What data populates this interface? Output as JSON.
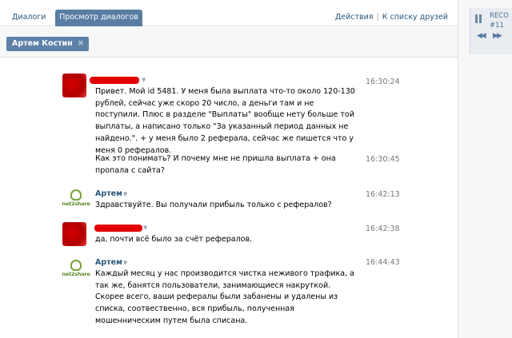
{
  "tabs": {
    "dialogs": "Диалоги",
    "view_dialogs": "Просмотр диалогов"
  },
  "top_actions": {
    "actions": "Действия",
    "separator": "|",
    "to_friends": "К списку друзей"
  },
  "filter": {
    "chip_label": "Артем Костин",
    "remove": "✖"
  },
  "player": {
    "label": "RECO",
    "number": "#11",
    "pause_icon": "pause-icon",
    "prev_icon": "rewind-icon",
    "next_icon": "fast-forward-icon"
  },
  "messages": [
    {
      "author": "",
      "author_redacted": true,
      "avatar": "red-avatar",
      "time": "16:30:24",
      "text": "Привет. Мой id 5481. У меня была выплата что-то около 120-130 рублей, сейчас уже скоро 20 число, а деньги там и не поступили. Плюс в разделе \"Выплаты\" вообще нету больше той выплаты, а написано только \"За указанный период данных не найдено.\". + у меня было 2 реферала, сейчас же пишется что у меня 0 рефералов."
    },
    {
      "time": "16:30:45",
      "text": "Как это понимать? И почему мне не пришла выплата + она пропала с сайта?"
    },
    {
      "author": "Артем",
      "avatar": "net2share-logo",
      "time": "16:42:13",
      "text": "Здравствуйте. Вы получали прибыль только с рефералов?"
    },
    {
      "author": "",
      "author_redacted": true,
      "avatar": "red-avatar",
      "time": "16:42:38",
      "text": "да, почти всё было за счёт рефералов."
    },
    {
      "author": "Артем",
      "avatar": "net2share-logo",
      "time": "16:44:43",
      "text": "Каждый месяц у нас производится чистка неживого трафика, а так же, банятся пользователи, занимающиеся накруткой. Скорее всего, ваши рефералы были забанены и удалены из списка, соотвественно, вся прибыль, полученная мошенническим путем была списана."
    }
  ],
  "logo_text": "net2share",
  "colors": {
    "accent": "#597da3",
    "link": "#2b587a",
    "redaction": "#e20000",
    "logo_green": "#79a23a"
  }
}
